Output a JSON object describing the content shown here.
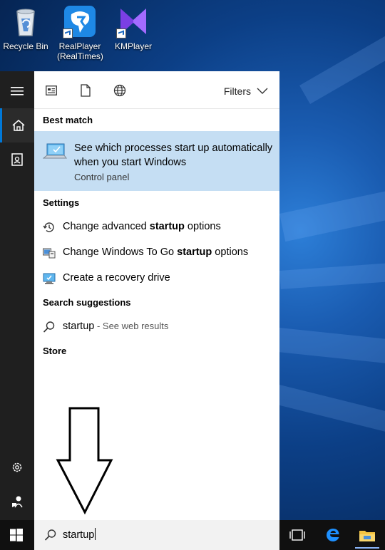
{
  "desktop": {
    "icons": [
      {
        "label": "Recycle Bin",
        "icon": "recycle-bin-icon"
      },
      {
        "label": "RealPlayer (RealTimes)",
        "icon": "realplayer-icon"
      },
      {
        "label": "KMPlayer",
        "icon": "kmplayer-icon"
      }
    ]
  },
  "rail": {
    "items": [
      {
        "name": "hamburger-menu-icon"
      },
      {
        "name": "home-icon"
      },
      {
        "name": "notebook-icon"
      },
      {
        "name": "settings-gear-icon"
      },
      {
        "name": "feedback-icon"
      }
    ]
  },
  "toolbar": {
    "filters_label": "Filters",
    "icons": [
      "apps-filter-icon",
      "documents-filter-icon",
      "web-filter-icon"
    ]
  },
  "best_match": {
    "heading": "Best match",
    "title": "See which processes start up automatically when you start Windows",
    "subtitle": "Control panel"
  },
  "settings": {
    "heading": "Settings",
    "items": [
      {
        "pre": "Change advanced ",
        "bold": "startup",
        "post": " options",
        "icon": "history-icon"
      },
      {
        "pre": "Change Windows To Go ",
        "bold": "startup",
        "post": " options",
        "icon": "windows-to-go-icon"
      },
      {
        "pre": "Create a recovery drive",
        "bold": "",
        "post": "",
        "icon": "recovery-drive-icon"
      }
    ]
  },
  "suggestions": {
    "heading": "Search suggestions",
    "query": "startup",
    "web_hint": " - See web results"
  },
  "store": {
    "heading": "Store"
  },
  "search": {
    "value": "startup"
  },
  "colors": {
    "accent": "#0078d7",
    "selection": "#c5def3",
    "rail": "#1f1f1f",
    "taskbar": "#101010"
  }
}
